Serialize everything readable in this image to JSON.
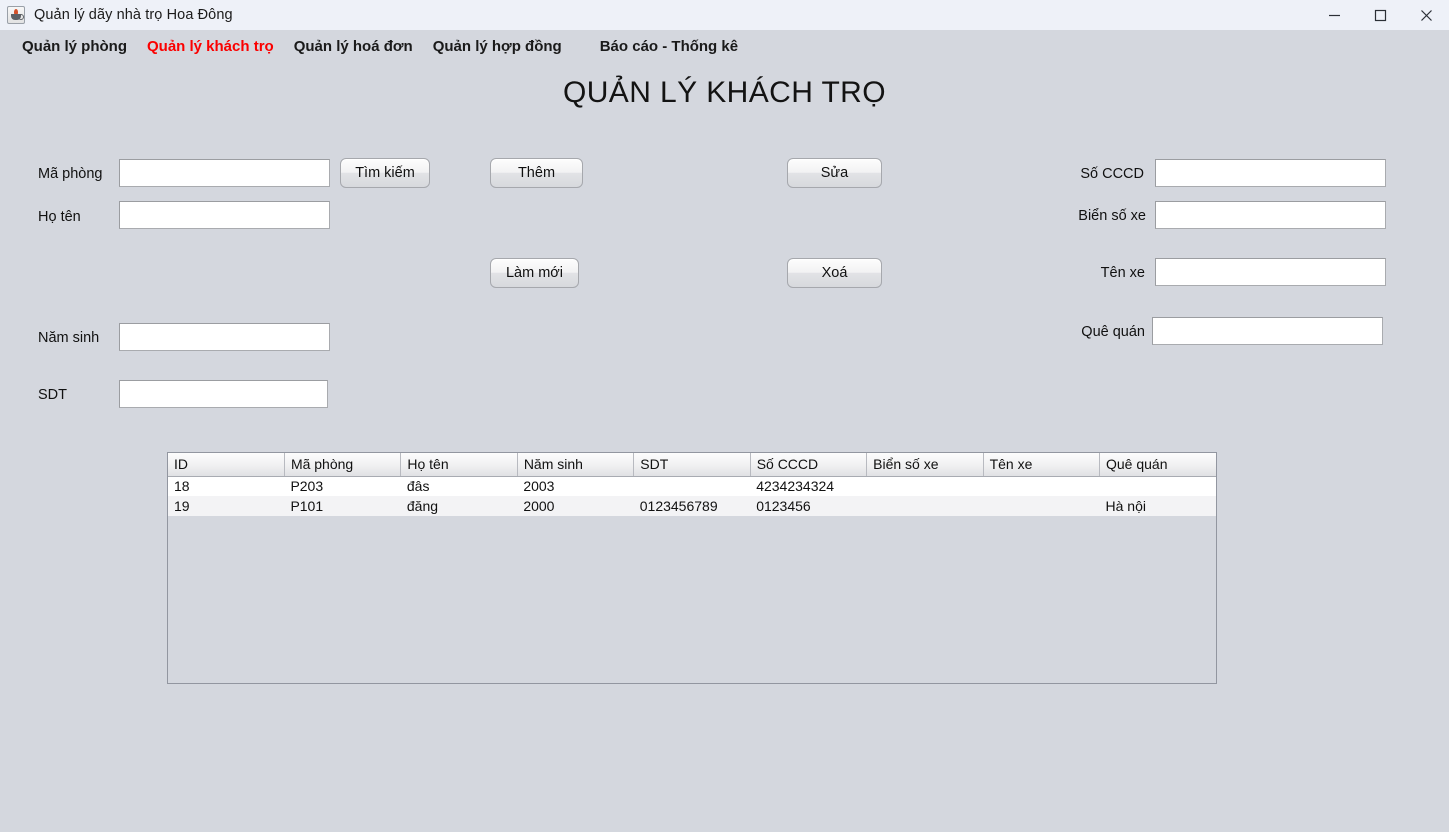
{
  "window": {
    "title": "Quản lý dãy nhà trọ Hoa Đông",
    "app_icon": "java-coffee-cup-icon",
    "controls": {
      "minimize": "minimize-icon",
      "maximize": "maximize-icon",
      "close": "close-icon"
    }
  },
  "menubar": {
    "items": [
      {
        "label": "Quản lý phòng",
        "active": false
      },
      {
        "label": "Quản lý khách trọ",
        "active": true
      },
      {
        "label": "Quản lý hoá đơn",
        "active": false
      },
      {
        "label": "Quản lý hợp đồng",
        "active": false
      },
      {
        "label": "Báo cáo - Thống kê",
        "active": false
      }
    ],
    "active_color": "#fb0000",
    "inactive_color": "#1a1a1a"
  },
  "page": {
    "heading": "QUẢN LÝ KHÁCH TRỌ",
    "background_color": "#d4d7de"
  },
  "form": {
    "left_fields": [
      {
        "label": "Mã phòng",
        "value": "",
        "placeholder": ""
      },
      {
        "label": "Họ tên",
        "value": "",
        "placeholder": ""
      },
      {
        "label": "Năm sinh",
        "value": "",
        "placeholder": ""
      },
      {
        "label": "SDT",
        "value": "",
        "placeholder": ""
      }
    ],
    "right_fields": [
      {
        "label": "Số CCCD",
        "value": "",
        "placeholder": ""
      },
      {
        "label": "Biển số xe",
        "value": "",
        "placeholder": ""
      },
      {
        "label": "Tên xe",
        "value": "",
        "placeholder": ""
      },
      {
        "label": "Quê quán",
        "value": "",
        "placeholder": ""
      }
    ]
  },
  "buttons": {
    "search": "Tìm kiếm",
    "add": "Thêm",
    "edit": "Sửa",
    "refresh": "Làm mới",
    "delete": "Xoá"
  },
  "table": {
    "columns": [
      "ID",
      "Mã phòng",
      "Họ tên",
      "Năm sinh",
      "SDT",
      "Số CCCD",
      "Biển số xe",
      "Tên xe",
      "Quê quán"
    ],
    "rows": [
      [
        "18",
        "P203",
        "đâs",
        "2003",
        "",
        "4234234324",
        "",
        "",
        ""
      ],
      [
        "19",
        "P101",
        "đăng",
        "2000",
        "0123456789",
        "0123456",
        "",
        "",
        "Hà nội"
      ]
    ]
  }
}
